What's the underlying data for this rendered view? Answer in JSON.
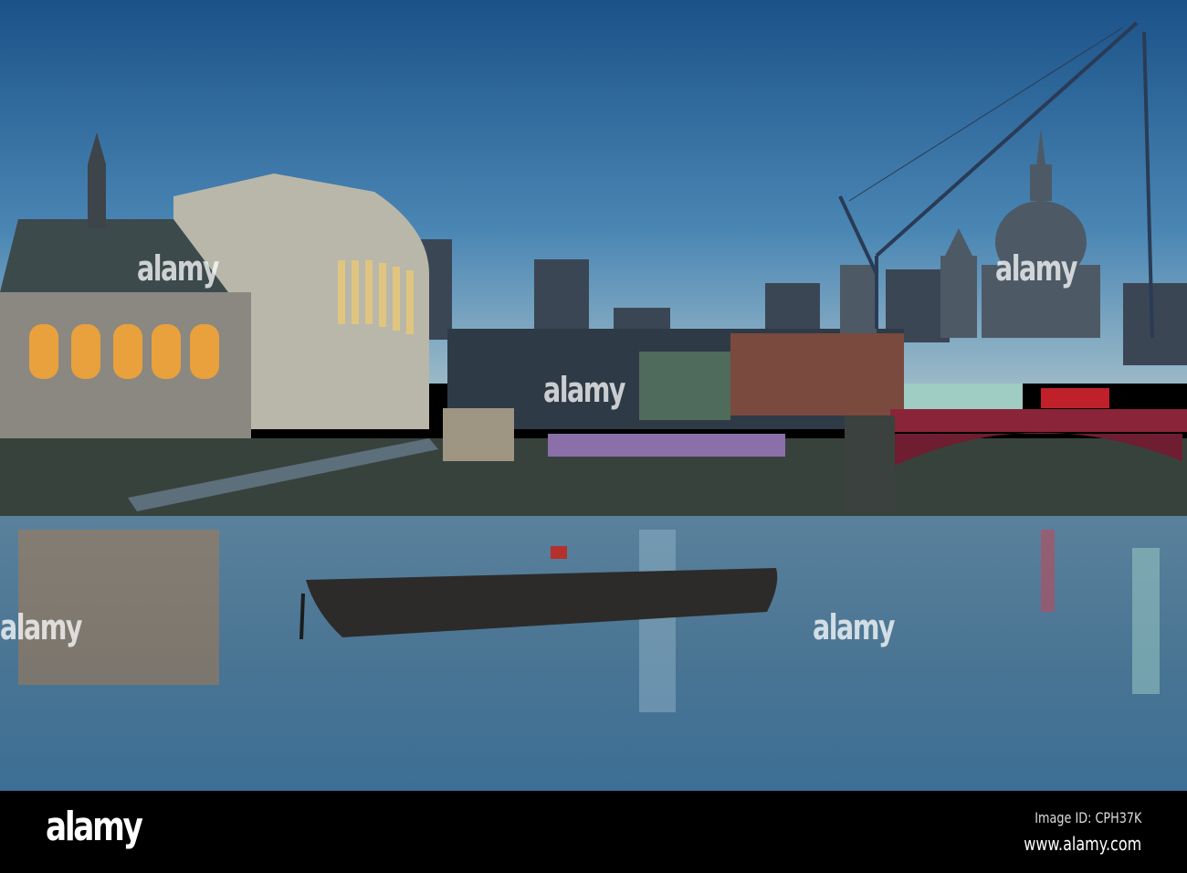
{
  "watermark": {
    "text": "alamy"
  },
  "footer": {
    "logo": "alamy",
    "image_id": "Image ID: CPH37K",
    "url": "www.alamy.com"
  },
  "colors": {
    "sky_top": "#1c5489",
    "sky_horizon": "#8fb1c6",
    "water": "#4f7898",
    "bridge": "#8a2438"
  }
}
